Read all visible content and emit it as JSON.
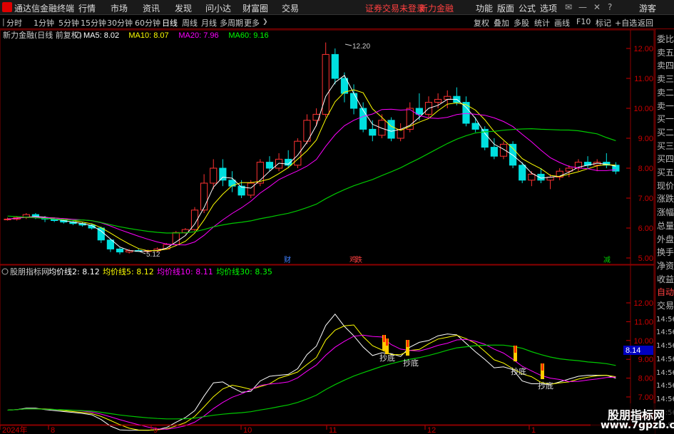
{
  "window": {
    "title": "通达信金融终端",
    "menu": [
      "行情",
      "市场",
      "资讯",
      "发现",
      "问小达",
      "财富圈",
      "交易"
    ],
    "notice": "证券交易未登录",
    "account": "新力金融",
    "right_menu": [
      "功能",
      "版面",
      "公式",
      "选项"
    ],
    "user": "游客"
  },
  "toolbar": {
    "periods": [
      "分时",
      "1分钟",
      "5分钟",
      "15分钟",
      "30分钟",
      "60分钟",
      "日线",
      "周线",
      "月线",
      "多周期",
      "更多"
    ],
    "active_period": "日线",
    "right": [
      "复权",
      "叠加",
      "多股",
      "统计",
      "画线",
      "F10",
      "标记",
      "+自选",
      "返回"
    ]
  },
  "main_panel": {
    "title": "新力金融(日线 前复权)",
    "ma": [
      {
        "label": "MA5: 8.02",
        "color": "#ffffff"
      },
      {
        "label": "MA10: 8.07",
        "color": "#ffff00"
      },
      {
        "label": "MA20: 7.96",
        "color": "#ff00ff"
      },
      {
        "label": "MA60: 9.16",
        "color": "#00ff00"
      }
    ],
    "high_label": "12.20",
    "low_label": "5.12",
    "events": [
      {
        "x": 398,
        "text": "财"
      },
      {
        "x": 490,
        "text": "鸡"
      },
      {
        "x": 498,
        "text": "跌"
      },
      {
        "x": 846,
        "text": "减"
      }
    ],
    "yticks": [
      "12.00",
      "11.00",
      "10.00",
      "9.00",
      "8.00",
      "7.00",
      "6.00",
      "5.00"
    ]
  },
  "indicator_panel": {
    "title": "股朋指标网",
    "lines": [
      {
        "label": "均价线2: 8.12",
        "color": "#ffffff"
      },
      {
        "label": "均价线5: 8.12",
        "color": "#ffff00"
      },
      {
        "label": "均价线10: 8.11",
        "color": "#ff00ff"
      },
      {
        "label": "均价线30: 8.35",
        "color": "#00ff00"
      }
    ],
    "yticks": [
      "12.00",
      "11.00",
      "10.00",
      "9.00",
      "8.00",
      "7.00",
      "6.00"
    ],
    "current": "8.14",
    "markers": [
      "抄底",
      "抄底",
      "抄底",
      "抄底",
      "抄底"
    ]
  },
  "xaxis": [
    "2024年",
    "8",
    "9",
    "10",
    "11",
    "12",
    "1"
  ],
  "sidebar": {
    "items": [
      "委比",
      "卖五",
      "卖四",
      "卖三",
      "卖二",
      "卖一",
      "买一",
      "买二",
      "买三",
      "买四",
      "买五",
      "现价",
      "涨跌",
      "涨幅",
      "总量",
      "外盘",
      "换手",
      "净资",
      "收益",
      "自动",
      "交易",
      "14:56",
      "14:56",
      "14:56",
      "14:56",
      "14:56",
      "14:56",
      "14:56",
      "14:56",
      "14:56"
    ]
  },
  "watermark": {
    "title": "股朋指标网",
    "url": "www.7gpzb.com"
  },
  "chart_data": {
    "type": "candlestick",
    "note": "approximate daily OHLC, about every other bar",
    "ohlc": [
      [
        6.3,
        6.35,
        6.25,
        6.3
      ],
      [
        6.3,
        6.4,
        6.25,
        6.35
      ],
      [
        6.35,
        6.5,
        6.3,
        6.45
      ],
      [
        6.45,
        6.5,
        6.3,
        6.35
      ],
      [
        6.35,
        6.4,
        6.2,
        6.3
      ],
      [
        6.3,
        6.35,
        6.2,
        6.25
      ],
      [
        6.25,
        6.3,
        6.15,
        6.2
      ],
      [
        6.2,
        6.25,
        6.1,
        6.15
      ],
      [
        6.15,
        6.2,
        6.05,
        6.1
      ],
      [
        6.1,
        6.15,
        5.95,
        6.0
      ],
      [
        6.0,
        6.05,
        5.5,
        5.6
      ],
      [
        5.6,
        5.65,
        5.2,
        5.3
      ],
      [
        5.3,
        5.35,
        5.12,
        5.2
      ],
      [
        5.2,
        5.3,
        5.15,
        5.25
      ],
      [
        5.25,
        5.3,
        5.2,
        5.22
      ],
      [
        5.22,
        5.28,
        5.18,
        5.24
      ],
      [
        5.24,
        5.35,
        5.2,
        5.3
      ],
      [
        5.3,
        5.5,
        5.28,
        5.45
      ],
      [
        5.45,
        5.9,
        5.4,
        5.85
      ],
      [
        5.85,
        6.0,
        5.8,
        5.95
      ],
      [
        5.95,
        6.7,
        5.9,
        6.6
      ],
      [
        6.6,
        7.8,
        6.5,
        7.5
      ],
      [
        7.5,
        8.3,
        7.3,
        8.0
      ],
      [
        8.0,
        8.3,
        7.4,
        7.6
      ],
      [
        7.6,
        7.9,
        7.2,
        7.4
      ],
      [
        7.4,
        7.6,
        7.0,
        7.1
      ],
      [
        7.1,
        7.6,
        7.0,
        7.5
      ],
      [
        7.5,
        8.3,
        7.4,
        8.2
      ],
      [
        8.2,
        8.4,
        7.9,
        8.0
      ],
      [
        8.0,
        8.5,
        7.9,
        8.3
      ],
      [
        8.3,
        8.6,
        8.0,
        8.1
      ],
      [
        8.1,
        9.0,
        8.0,
        8.9
      ],
      [
        8.9,
        9.8,
        8.8,
        9.6
      ],
      [
        9.6,
        10.0,
        9.4,
        9.8
      ],
      [
        9.8,
        12.2,
        9.7,
        11.8
      ],
      [
        11.8,
        12.0,
        10.8,
        11.0
      ],
      [
        11.0,
        11.2,
        10.2,
        10.5
      ],
      [
        10.5,
        10.8,
        9.8,
        10.0
      ],
      [
        10.0,
        10.2,
        9.2,
        9.3
      ],
      [
        9.3,
        9.6,
        8.9,
        9.1
      ],
      [
        9.1,
        9.8,
        9.0,
        9.6
      ],
      [
        9.6,
        9.7,
        8.9,
        9.0
      ],
      [
        9.0,
        9.5,
        8.9,
        9.3
      ],
      [
        9.3,
        10.2,
        9.2,
        10.0
      ],
      [
        10.0,
        10.5,
        9.6,
        9.8
      ],
      [
        9.8,
        10.4,
        9.7,
        10.2
      ],
      [
        10.2,
        10.5,
        10.0,
        10.3
      ],
      [
        10.3,
        10.6,
        10.0,
        10.4
      ],
      [
        10.4,
        10.7,
        10.1,
        10.2
      ],
      [
        10.2,
        10.4,
        9.4,
        9.5
      ],
      [
        9.5,
        9.7,
        9.2,
        9.3
      ],
      [
        9.3,
        9.4,
        8.6,
        8.7
      ],
      [
        8.7,
        9.0,
        8.3,
        8.4
      ],
      [
        8.4,
        8.9,
        8.3,
        8.8
      ],
      [
        8.8,
        8.9,
        8.0,
        8.1
      ],
      [
        8.1,
        8.2,
        7.5,
        7.6
      ],
      [
        7.6,
        7.9,
        7.4,
        7.8
      ],
      [
        7.8,
        8.0,
        7.5,
        7.6
      ],
      [
        7.6,
        7.8,
        7.3,
        7.7
      ],
      [
        7.7,
        8.0,
        7.6,
        7.9
      ],
      [
        7.9,
        8.1,
        7.7,
        8.0
      ],
      [
        8.0,
        8.3,
        7.9,
        8.2
      ],
      [
        8.2,
        8.4,
        8.0,
        8.1
      ],
      [
        8.1,
        8.3,
        7.9,
        8.2
      ],
      [
        8.2,
        8.5,
        8.0,
        8.1
      ],
      [
        8.1,
        8.2,
        7.8,
        7.9
      ]
    ]
  }
}
